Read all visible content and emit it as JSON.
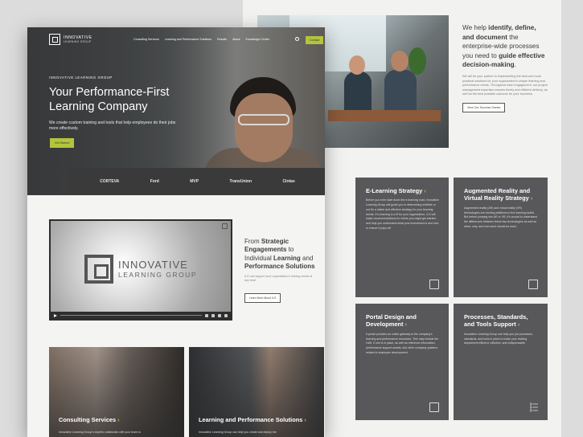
{
  "back_page": {
    "intro": {
      "heading_parts": [
        {
          "text": "We help ",
          "bold": false
        },
        {
          "text": "identify, define, and document",
          "bold": true
        },
        {
          "text": " the enterprise-wide processes you need to ",
          "bold": false
        },
        {
          "text": "guide effective decision-making",
          "bold": true
        },
        {
          "text": ".",
          "bold": false
        }
      ],
      "body": "We will be your partner in implementing the best and most practical solutions for your organization's unique learning and performance needs. Throughout each engagement, our project management expertise ensures timely and efficient delivery, as well as the best possible outcome for your business.",
      "button": "View Our Success Stories"
    },
    "cards": [
      {
        "title": "E-Learning Strategy",
        "body": "Before you even start down the e-learning road, Innovative Learning Group will guide you in determining whether or not it's a viable and effective strategy for your learning needs. If e-learning is a fit for your organization, ILG will make recommendations for where you might get started, and help you understand what your investment is and how to ensure it pays off.",
        "icon": "monitor-icon"
      },
      {
        "title": "Augmented Reality and Virtual Reality Strategy",
        "body": "Augmented reality (AR) and virtual reality (VR) technologies are exciting additions to the learning toolkit. But before jumping into AR or VR, it's crucial to understand the differences between these two technologies as well as when, why, and how each should be used.",
        "icon": "vr-headset-icon"
      },
      {
        "title": "Portal Design and Development",
        "body": "A portal provides an online gateway to the company's learning and performance resources. This may include the LMS, if one is in place, as well as reference information, performance support assets, and other company systems related to employee development.",
        "icon": "portal-icon"
      },
      {
        "title": "Processes, Standards, and Tools Support",
        "body": "Innovative Learning Group can help you put processes, standards, and tools in place to make your training department efficient, effective, and indispensable.",
        "icon": "checklist-icon"
      }
    ]
  },
  "front_page": {
    "logo": {
      "line1": "INNOVATIVE",
      "line2": "LEARNING GROUP"
    },
    "nav": [
      "Consulting Services",
      "Learning and Performance Solutions",
      "Results",
      "About",
      "Knowledge Center"
    ],
    "contact": "Contact",
    "hero": {
      "eyebrow": "INNOVATIVE LEARNING GROUP",
      "headline": "Your Performance-First Learning Company",
      "sub": "We create custom training and tools that help employees do their jobs more effectively.",
      "cta": "Get Started"
    },
    "client_logos": [
      "CORTEVA",
      "Ford",
      "MVP",
      "TransUnion",
      "Cintas"
    ],
    "video": {
      "logo_line1": "INNOVATIVE",
      "logo_line2": "LEARNING GROUP"
    },
    "strategic": {
      "parts": [
        {
          "text": "From ",
          "bold": false
        },
        {
          "text": "Strategic Engagements",
          "bold": true
        },
        {
          "text": " to Individual ",
          "bold": false
        },
        {
          "text": "Learning",
          "bold": true
        },
        {
          "text": " and ",
          "bold": false
        },
        {
          "text": "Performance Solutions",
          "bold": true
        }
      ],
      "body": "ILG can support your organization's training needs at any level.",
      "button": "Learn More About ILG"
    },
    "services": [
      {
        "title": "Consulting Services",
        "body": "Innovative Learning Group's experts collaborate with your team to"
      },
      {
        "title": "Learning and Performance Solutions",
        "body": "Innovative Learning Group can help you create and deploy the"
      }
    ]
  },
  "colors": {
    "accent": "#b4c43c",
    "card": "#58585b",
    "dark": "#3a3a3a"
  }
}
